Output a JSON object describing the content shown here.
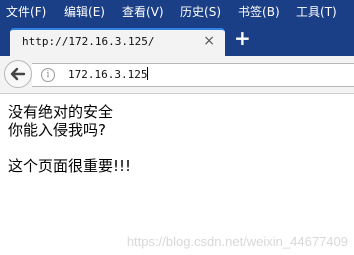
{
  "menubar": {
    "items": [
      {
        "label": "文件",
        "key": "F"
      },
      {
        "label": "编辑",
        "key": "E"
      },
      {
        "label": "查看",
        "key": "V"
      },
      {
        "label": "历史",
        "key": "S"
      },
      {
        "label": "书签",
        "key": "B"
      },
      {
        "label": "工具",
        "key": "T"
      }
    ]
  },
  "tab": {
    "title": "http://172.16.3.125/",
    "close_glyph": "×"
  },
  "new_tab": {
    "glyph": "+"
  },
  "navbar": {
    "url": "172.16.3.125",
    "info_glyph": "i"
  },
  "content": {
    "lines": [
      "没有绝对的安全",
      "你能入侵我吗?",
      "这个页面很重要!!!"
    ]
  },
  "watermark": "https://blog.csdn.net/weixin_44677409",
  "colors": {
    "menubar_bg": "#1a3f86",
    "tab_accent": "#2e82e6"
  }
}
